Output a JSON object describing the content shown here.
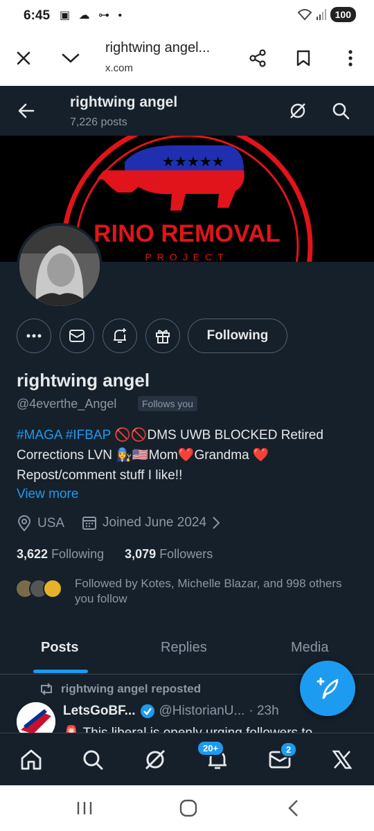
{
  "status_bar": {
    "time": "6:45",
    "icons_left": "▣ ☁ ⊶ •",
    "battery": "100"
  },
  "browser": {
    "title": "rightwing angel...",
    "url": "x.com"
  },
  "header": {
    "name": "rightwing angel",
    "post_count": "7,226 posts"
  },
  "banner": {
    "text_main": "RINO REMOVAL",
    "text_sub": "PROJECT"
  },
  "profile": {
    "following_button": "Following",
    "display_name": "rightwing angel",
    "handle": "@4everthe_Angel",
    "follows_you": "Follows you",
    "bio_tag1": "#MAGA",
    "bio_tag2": "#IFBAP",
    "bio_rest": "🚫🚫DMS UWB BLOCKED Retired Corrections LVN 👩‍🔧🇺🇸Mom❤️Grandma ❤️ Repost/comment stuff I like!!",
    "view_more": "View more",
    "location": "USA",
    "joined": "Joined June 2024",
    "following_count": "3,622",
    "following_label": "Following",
    "followers_count": "3,079",
    "followers_label": "Followers",
    "followed_by": "Followed by Kotes, Michelle Blazar, and 998 others you follow"
  },
  "tabs": [
    "Posts",
    "Replies",
    "Media"
  ],
  "feed": {
    "repost_line": "rightwing angel reposted",
    "tweet_name": "LetsGoBF...",
    "tweet_handle": "@HistorianU...",
    "tweet_time": "· 23h",
    "tweet_text": "🚨 This liberal is openly urging followers to"
  },
  "bottom_nav": {
    "notifications_badge": "20+",
    "messages_badge": "2"
  },
  "colors": {
    "background": "#15202b",
    "accent": "#1d9bf0",
    "secondary_text": "#8b98a5",
    "border": "#38444d"
  },
  "icons": [
    "close-icon",
    "chevron-down-icon",
    "share-icon",
    "bookmark-icon",
    "more-vertical-icon",
    "back-arrow-icon",
    "grok-icon",
    "search-icon",
    "more-icon",
    "mail-icon",
    "bell-plus-icon",
    "gift-icon",
    "location-icon",
    "calendar-icon",
    "chevron-right-icon",
    "repost-icon",
    "verified-icon",
    "compose-icon",
    "home-icon",
    "notifications-icon",
    "x-logo-icon"
  ]
}
